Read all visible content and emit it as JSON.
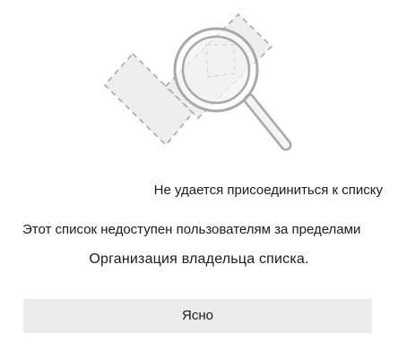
{
  "dialog": {
    "title": "Не удается присоединиться к списку",
    "message_line1": "Этот список недоступен пользователям за пределами",
    "message_line2": "Организация владельца списка.",
    "ok_label": "Ясно"
  },
  "illustration": {
    "icon": "magnifier-icon"
  }
}
